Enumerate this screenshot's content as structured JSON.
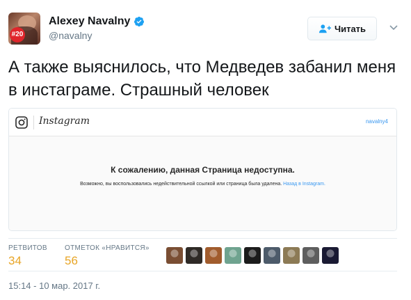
{
  "user": {
    "name": "Alexey Navalny",
    "handle": "@navalny",
    "avatar_badge": "#20"
  },
  "follow_button": {
    "label": "Читать"
  },
  "tweet": {
    "text": "А также выяснилось, что Медведев забанил меня в инстаграме. Страшный человек"
  },
  "embed": {
    "brand": "Instagram",
    "username": "navalny4",
    "title": "К сожалению, данная Страница недоступна.",
    "message": "Возможно, вы воспользовались недействительной ссылкой или страница была удалена.",
    "back_link": "Назад в Instagram."
  },
  "stats": {
    "retweets_label": "РЕТВИТОВ",
    "retweets_count": "34",
    "likes_label": "ОТМЕТОК «НРАВИТСЯ»",
    "likes_count": "56"
  },
  "likers": [
    {
      "name": "liker-avatar-1",
      "color": "#7a4e33"
    },
    {
      "name": "liker-avatar-2",
      "color": "#2f2a26"
    },
    {
      "name": "liker-avatar-3",
      "color": "#a15c2d"
    },
    {
      "name": "liker-avatar-4",
      "color": "#6fa38f"
    },
    {
      "name": "liker-avatar-5",
      "color": "#1c1c1c"
    },
    {
      "name": "liker-avatar-6",
      "color": "#4d5b6a"
    },
    {
      "name": "liker-avatar-7",
      "color": "#8c7a55"
    },
    {
      "name": "liker-avatar-8",
      "color": "#5e5e5e"
    },
    {
      "name": "liker-avatar-9",
      "color": "#1a1a33"
    }
  ],
  "timestamp": "15:14 - 10 мар. 2017 г.",
  "colors": {
    "verified": "#1da1f2",
    "link": "#3897f0",
    "stat_value": "#e8a526",
    "badge": "#e0252b"
  }
}
